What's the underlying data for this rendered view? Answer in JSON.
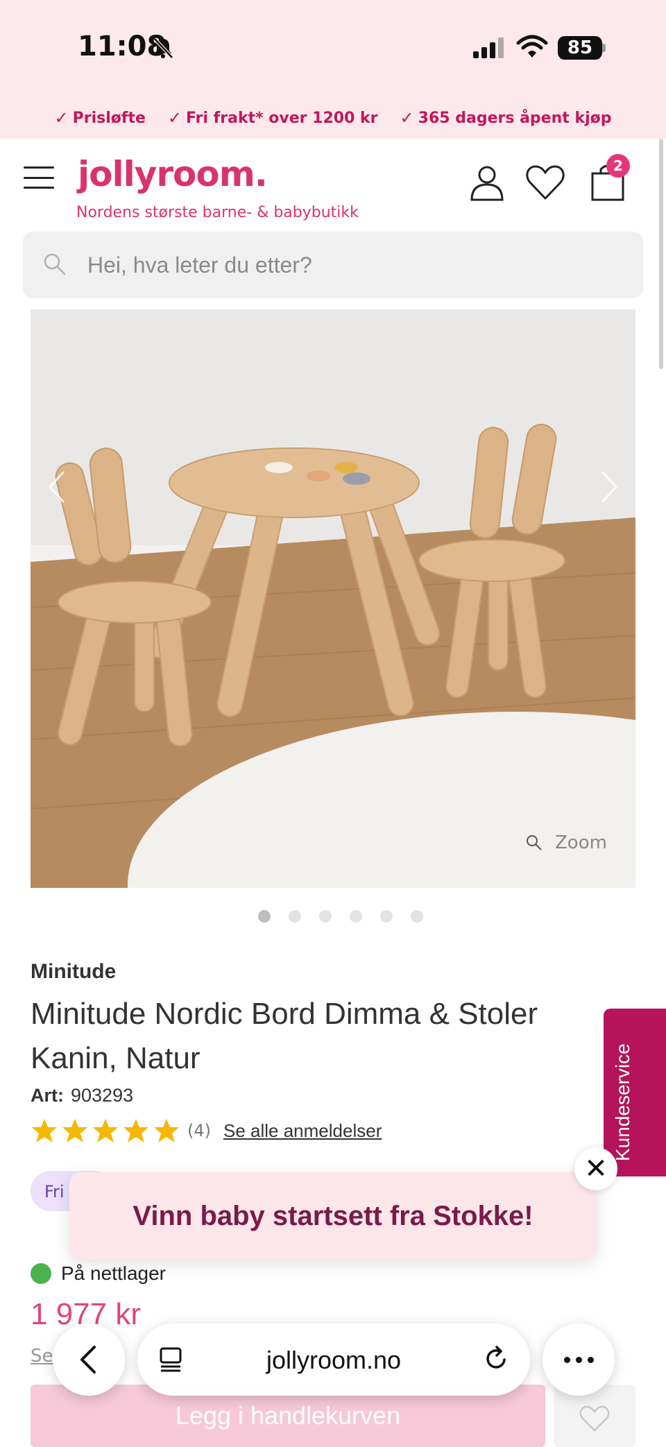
{
  "status_bar": {
    "time": "11:08",
    "battery": "85"
  },
  "usp": [
    {
      "label": "Prisløfte"
    },
    {
      "label": "Fri frakt* over 1200 kr"
    },
    {
      "label": "365 dagers åpent kjøp"
    }
  ],
  "header": {
    "logo": "jollyroom.",
    "tagline": "Nordens største barne- & babybutikk",
    "cart_count": "2"
  },
  "search": {
    "placeholder": "Hei, hva leter du etter?"
  },
  "gallery": {
    "zoom_label": "Zoom",
    "dot_count": 6,
    "active_index": 0
  },
  "product": {
    "brand": "Minitude",
    "title": "Minitude Nordic Bord Dimma & Stoler Kanin, Natur",
    "art_label": "Art:",
    "art_number": "903293",
    "rating": 5,
    "review_count": "(4)",
    "review_link": "Se alle anmeldelser",
    "tag": "Fri",
    "stock": "På nettlager",
    "price": "1 977 kr",
    "small_link": "Se",
    "cart_button": "Legg i handlekurven"
  },
  "promo": {
    "text": "Vinn baby startsett fra Stokke!",
    "close": "✕"
  },
  "side_tab": {
    "label": "Kundeservice"
  },
  "browser": {
    "url": "jollyroom.no"
  },
  "colors": {
    "brand": "#d9336d",
    "promo_bg": "#fde6ea",
    "side_tab": "#b5145b",
    "stock": "#4cb24f"
  }
}
